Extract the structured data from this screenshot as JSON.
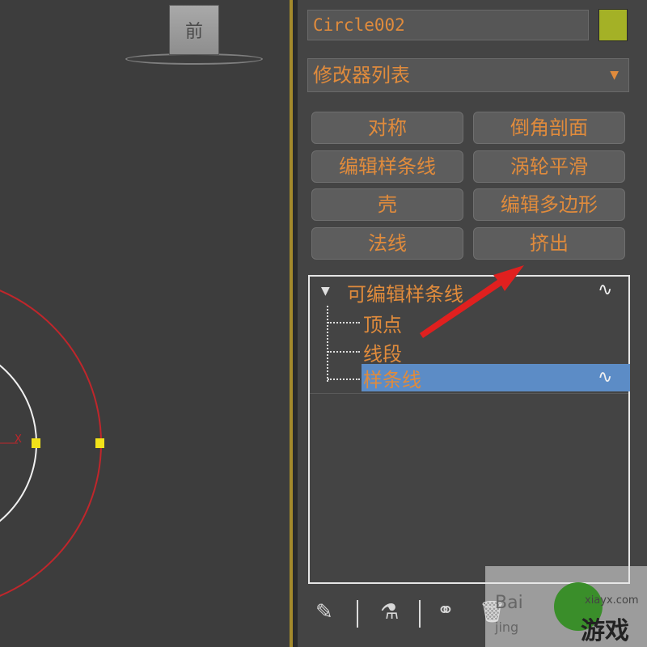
{
  "viewport": {
    "viewcube_label": "前",
    "axis_label": "X"
  },
  "panel": {
    "object_name": "Circle002",
    "object_color": "#a4b126",
    "modifier_list": "修改器列表",
    "modifier_buttons": [
      "对称",
      "倒角剖面",
      "编辑样条线",
      "涡轮平滑",
      "壳",
      "编辑多边形",
      "法线",
      "挤出"
    ]
  },
  "stack": {
    "root": "可编辑样条线",
    "children": [
      "顶点",
      "线段",
      "样条线"
    ],
    "selected": "样条线"
  },
  "toolbar": {
    "icons": [
      "pin-icon",
      "show-end-result-icon",
      "make-unique-icon",
      "remove-modifier-icon"
    ]
  },
  "watermark": {
    "baidu": "Bai",
    "jing": "jing",
    "site": "xiayx.com",
    "brand": "游戏"
  },
  "colors": {
    "accent_text": "#e08b3c",
    "selection": "#5c8cc6",
    "annotation": "#e0201f"
  }
}
